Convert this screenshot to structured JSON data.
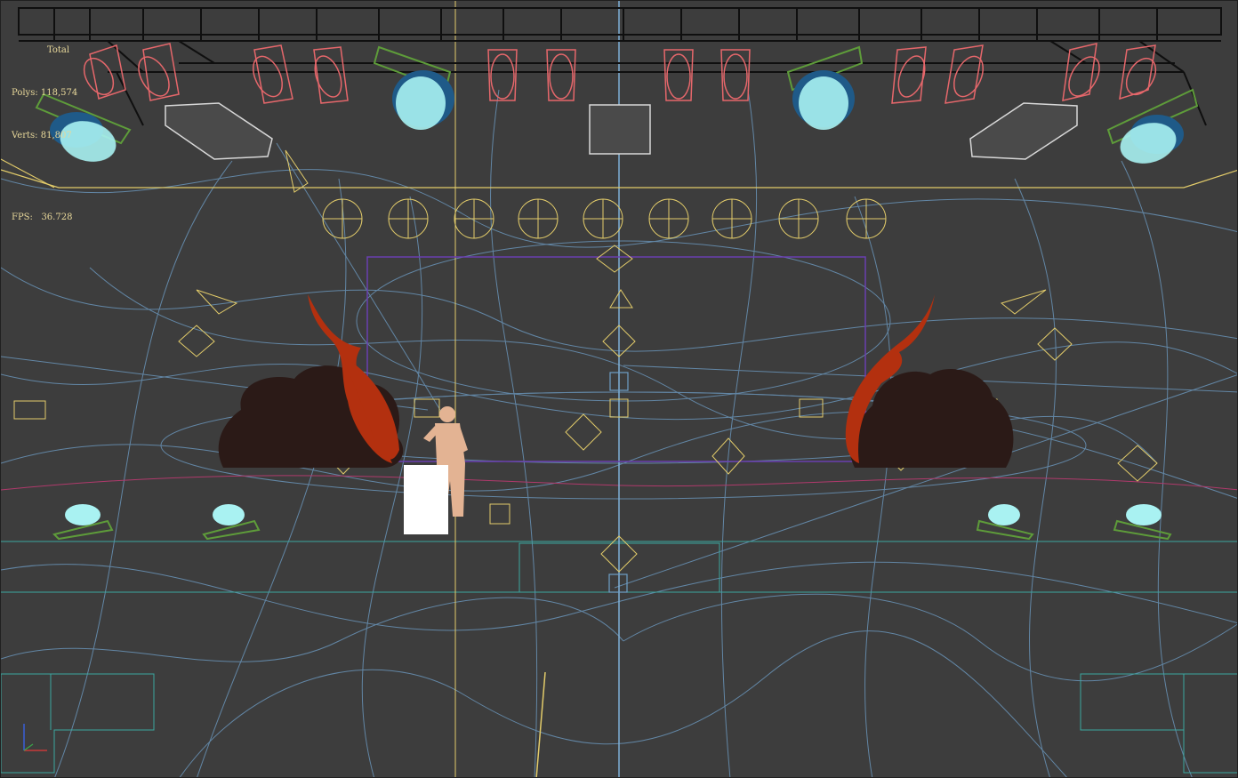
{
  "viewport": {
    "stats": {
      "total_label": "Total",
      "polys_label": "Polys:",
      "polys_value": "118,574",
      "verts_label": "Verts:",
      "verts_value": "81,807",
      "fps_label": "FPS:",
      "fps_value": "36.728"
    },
    "colors": {
      "background": "#3d3d3d",
      "stats_text": "#e8d89a",
      "wire_blue": "#6f9fc8",
      "wire_yellow": "#e3cc6a",
      "spot_red": "#e6676b",
      "truss": "#0f0f0f",
      "cyan_light": "#a9f2f2",
      "teal_floor": "#3aa7a0",
      "flame": "#b3300f",
      "smoke": "#2b1a17",
      "figure": "#e3b393"
    },
    "icons": [
      "axis-gizmo-icon"
    ]
  }
}
